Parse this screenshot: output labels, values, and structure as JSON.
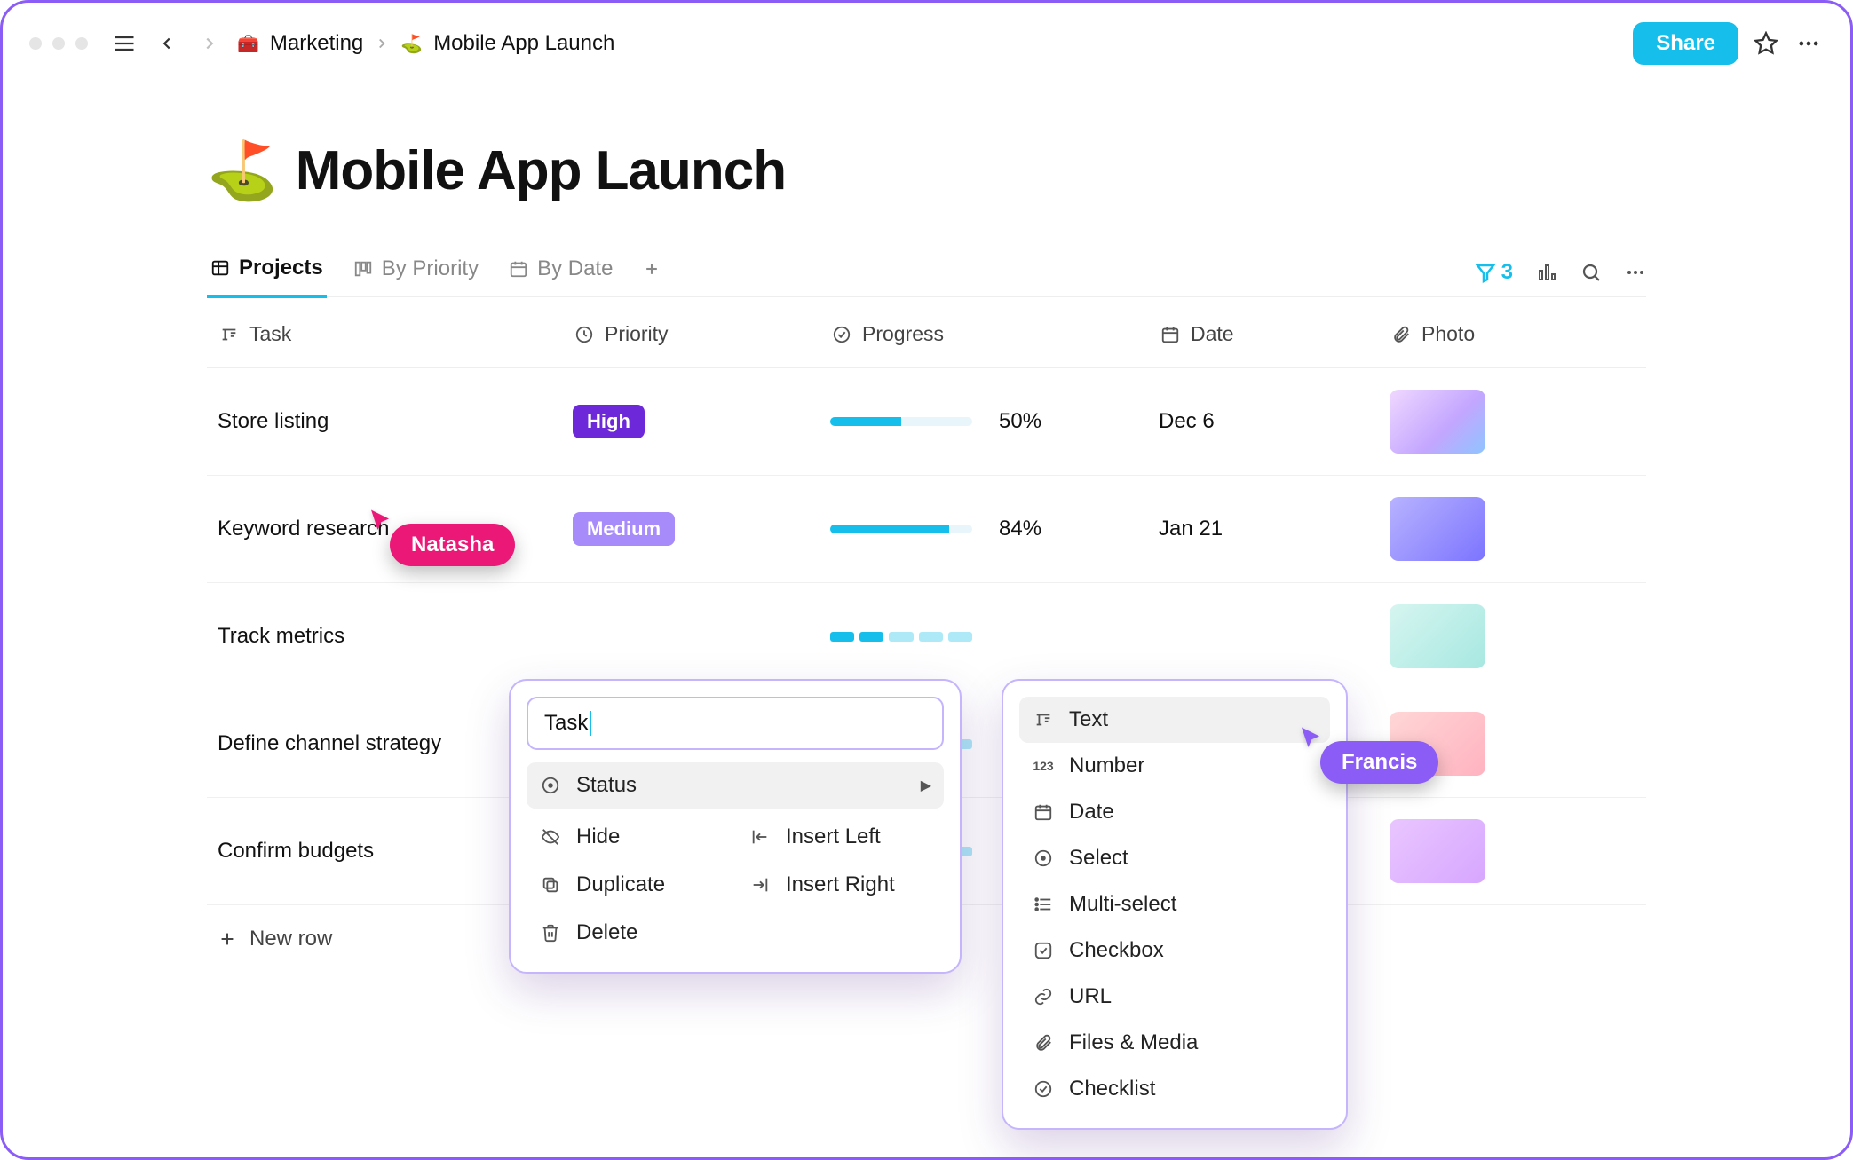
{
  "topbar": {
    "breadcrumb": {
      "parent_emoji": "🧰",
      "parent_label": "Marketing",
      "page_emoji": "⛳",
      "page_label": "Mobile App Launch"
    },
    "share_label": "Share"
  },
  "page": {
    "emoji": "⛳",
    "title": "Mobile App Launch"
  },
  "tabs": [
    {
      "label": "Projects",
      "icon": "table-icon",
      "active": true
    },
    {
      "label": "By Priority",
      "icon": "board-icon",
      "active": false
    },
    {
      "label": "By Date",
      "icon": "calendar-icon",
      "active": false
    }
  ],
  "tabs_right": {
    "filter_count": "3"
  },
  "columns": {
    "task": "Task",
    "priority": "Priority",
    "progress": "Progress",
    "date": "Date",
    "photo": "Photo"
  },
  "rows": [
    {
      "task": "Store listing",
      "priority": "High",
      "priority_class": "pri-high",
      "progress_pct": 50,
      "progress_label": "50%",
      "date": "Dec 6",
      "thumb_css": "linear-gradient(135deg,#f0d8ff,#c3a6ff 60%,#8ec5ff)"
    },
    {
      "task": "Keyword research",
      "priority": "Medium",
      "priority_class": "pri-med",
      "progress_pct": 84,
      "progress_label": "84%",
      "date": "Jan 21",
      "thumb_css": "linear-gradient(135deg,#b8b3ff,#7c74ff)"
    },
    {
      "task": "Track metrics",
      "priority": "",
      "priority_class": "",
      "progress_pct": null,
      "progress_label": "",
      "date": "",
      "thumb_css": "linear-gradient(135deg,#d6f5f0,#a7e8e1)"
    },
    {
      "task": "Define channel strategy",
      "priority": "",
      "priority_class": "",
      "progress_pct": null,
      "progress_label": "",
      "date": "",
      "thumb_css": "linear-gradient(135deg,#ffd6d6,#ffb3c0)"
    },
    {
      "task": "Confirm budgets",
      "priority": "",
      "priority_class": "",
      "progress_pct": null,
      "progress_label": "",
      "date": "",
      "thumb_css": "linear-gradient(135deg,#e9c6ff,#d7a6ff)"
    }
  ],
  "new_row_label": "New row",
  "cursor_users": {
    "natasha": "Natasha",
    "francis": "Francis"
  },
  "column_menu": {
    "input_value": "Task",
    "status_label": "Status",
    "actions": {
      "hide": "Hide",
      "duplicate": "Duplicate",
      "delete": "Delete",
      "insert_left": "Insert Left",
      "insert_right": "Insert Right"
    }
  },
  "type_menu": {
    "items": [
      {
        "icon": "text-type-icon",
        "label": "Text",
        "hl": true
      },
      {
        "icon": "number-type-icon",
        "label": "Number"
      },
      {
        "icon": "date-type-icon",
        "label": "Date"
      },
      {
        "icon": "select-type-icon",
        "label": "Select"
      },
      {
        "icon": "multiselect-type-icon",
        "label": "Multi-select"
      },
      {
        "icon": "checkbox-type-icon",
        "label": "Checkbox"
      },
      {
        "icon": "url-type-icon",
        "label": "URL"
      },
      {
        "icon": "files-type-icon",
        "label": "Files & Media"
      },
      {
        "icon": "checklist-type-icon",
        "label": "Checklist"
      }
    ]
  }
}
